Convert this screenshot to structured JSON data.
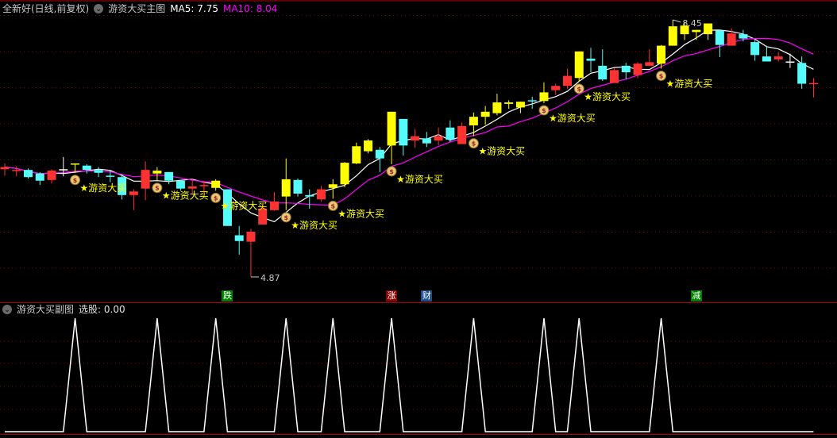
{
  "header": {
    "stock_title": "全新好(日线,前复权)",
    "main_indicator": "游资大买主图",
    "ma5_label": "MA5: 7.75",
    "ma10_label": "MA10: 8.04"
  },
  "sub_header": {
    "indicator": "游资大买副图",
    "value_label": "选股: 0.00"
  },
  "colors": {
    "up": "#ff3232",
    "down": "#54fcfc",
    "signal_candle": "#ffff00",
    "doji": "#ffffff",
    "ma5": "#ffffff",
    "ma10": "#ff00ff",
    "grid": "#8b0000",
    "separator": "#b00000"
  },
  "signal_label": "★游资大买",
  "annotations": {
    "low_label": "4.87",
    "high_label": "8.45"
  },
  "markers": [
    {
      "text": "跌",
      "candle": 19,
      "color": "#008000"
    },
    {
      "text": "涨",
      "candle": 33,
      "color": "#8b0000"
    },
    {
      "text": "财",
      "candle": 36,
      "color": "#1f4e8c"
    },
    {
      "text": "减",
      "candle": 59,
      "color": "#008000"
    }
  ],
  "chart_data": [
    {
      "type": "candlestick",
      "title": "游资大买主图",
      "ylim": [
        4.87,
        8.45
      ],
      "ma_periods": [
        5,
        10
      ],
      "candles": [
        [
          "r",
          6.37,
          6.45,
          6.28,
          6.4
        ],
        [
          "r",
          6.35,
          6.41,
          6.27,
          6.36
        ],
        [
          "c",
          6.36,
          6.38,
          6.24,
          6.26
        ],
        [
          "c",
          6.31,
          6.33,
          6.15,
          6.21
        ],
        [
          "r",
          6.22,
          6.37,
          6.17,
          6.35
        ],
        [
          "w",
          6.37,
          6.54,
          6.27,
          6.37
        ],
        [
          "y",
          6.44,
          6.45,
          6.32,
          6.45
        ],
        [
          "c",
          6.42,
          6.44,
          6.31,
          6.36
        ],
        [
          "c",
          6.36,
          6.4,
          6.26,
          6.32
        ],
        [
          "c",
          6.28,
          6.35,
          6.19,
          6.27
        ],
        [
          "c",
          6.26,
          6.3,
          5.95,
          6.01
        ],
        [
          "r",
          6.01,
          6.09,
          5.8,
          6.06
        ],
        [
          "r",
          6.1,
          6.48,
          5.94,
          6.36
        ],
        [
          "y",
          6.31,
          6.4,
          6.21,
          6.35
        ],
        [
          "c",
          6.33,
          6.33,
          6.16,
          6.21
        ],
        [
          "c",
          6.21,
          6.22,
          6.07,
          6.1
        ],
        [
          "r",
          6.1,
          6.24,
          6.02,
          6.13
        ],
        [
          "r",
          6.14,
          6.21,
          6.04,
          6.15
        ],
        [
          "y",
          6.11,
          6.23,
          6.07,
          6.21
        ],
        [
          "c",
          6.09,
          6.09,
          5.58,
          5.58
        ],
        [
          "c",
          5.45,
          5.58,
          5.18,
          5.37
        ],
        [
          "r",
          5.36,
          5.54,
          4.87,
          5.5
        ],
        [
          "r",
          5.6,
          5.88,
          5.6,
          5.82
        ],
        [
          "r",
          5.8,
          6.05,
          5.79,
          5.92
        ],
        [
          "y",
          5.99,
          6.52,
          5.8,
          6.23
        ],
        [
          "c",
          6.22,
          6.24,
          5.99,
          6.03
        ],
        [
          "c",
          6.01,
          6.09,
          5.82,
          5.99
        ],
        [
          "r",
          5.95,
          6.14,
          5.92,
          6.09
        ],
        [
          "y",
          6.11,
          6.23,
          5.96,
          6.16
        ],
        [
          "y",
          6.16,
          6.47,
          6.12,
          6.46
        ],
        [
          "y",
          6.45,
          6.74,
          6.44,
          6.69
        ],
        [
          "y",
          6.62,
          6.79,
          6.59,
          6.77
        ],
        [
          "c",
          6.64,
          6.68,
          6.33,
          6.52
        ],
        [
          "y",
          6.7,
          7.17,
          6.44,
          7.17
        ],
        [
          "c",
          7.07,
          7.07,
          6.56,
          6.7
        ],
        [
          "r",
          6.77,
          6.93,
          6.67,
          6.83
        ],
        [
          "c",
          6.8,
          6.89,
          6.68,
          6.73
        ],
        [
          "r",
          6.77,
          6.95,
          6.7,
          6.83
        ],
        [
          "c",
          6.95,
          7.05,
          6.75,
          6.78
        ],
        [
          "r",
          6.72,
          7.02,
          6.72,
          6.97
        ],
        [
          "y",
          6.98,
          7.16,
          6.83,
          7.1
        ],
        [
          "y",
          7.1,
          7.25,
          6.99,
          7.17
        ],
        [
          "y",
          7.15,
          7.42,
          7.12,
          7.3
        ],
        [
          "y",
          7.28,
          7.33,
          7.21,
          7.3
        ],
        [
          "y",
          7.23,
          7.31,
          7.15,
          7.31
        ],
        [
          "c",
          7.33,
          7.38,
          7.21,
          7.32
        ],
        [
          "y",
          7.32,
          7.58,
          7.29,
          7.44
        ],
        [
          "r",
          7.47,
          7.56,
          7.4,
          7.53
        ],
        [
          "r",
          7.53,
          7.77,
          7.49,
          7.67
        ],
        [
          "y",
          7.64,
          8.01,
          7.59,
          8.01
        ],
        [
          "c",
          7.91,
          8.06,
          7.72,
          7.88
        ],
        [
          "c",
          7.81,
          8.04,
          7.6,
          7.62
        ],
        [
          "r",
          7.57,
          7.78,
          7.57,
          7.75
        ],
        [
          "c",
          7.81,
          7.85,
          7.62,
          7.72
        ],
        [
          "r",
          7.68,
          7.86,
          7.64,
          7.84
        ],
        [
          "r",
          7.81,
          8.04,
          7.81,
          7.86
        ],
        [
          "y",
          7.84,
          8.1,
          7.77,
          8.09
        ],
        [
          "y",
          8.09,
          8.45,
          8.09,
          8.36
        ],
        [
          "y",
          8.25,
          8.42,
          8.17,
          8.37
        ],
        [
          "y",
          8.28,
          8.31,
          8.17,
          8.31
        ],
        [
          "y",
          8.25,
          8.4,
          8.17,
          8.4
        ],
        [
          "c",
          8.3,
          8.31,
          7.93,
          8.1
        ],
        [
          "r",
          8.09,
          8.33,
          8.09,
          8.26
        ],
        [
          "c",
          8.25,
          8.31,
          8.15,
          8.19
        ],
        [
          "c",
          8.14,
          8.17,
          7.88,
          7.96
        ],
        [
          "c",
          7.94,
          8.09,
          7.87,
          7.87
        ],
        [
          "r",
          7.9,
          8.0,
          7.87,
          7.94
        ],
        [
          "w",
          7.87,
          7.98,
          7.78,
          7.87
        ],
        [
          "c",
          7.85,
          7.94,
          7.49,
          7.56
        ],
        [
          "r",
          7.56,
          7.64,
          7.37,
          7.57
        ]
      ],
      "candle_fields": [
        "type",
        "open",
        "high",
        "low",
        "close"
      ]
    },
    {
      "type": "line",
      "title": "游资大买副图",
      "series_name": "选股",
      "ylim": [
        0,
        1
      ],
      "signal_candles": [
        6,
        13,
        18,
        24,
        28,
        33,
        40,
        46,
        49,
        56
      ]
    }
  ]
}
